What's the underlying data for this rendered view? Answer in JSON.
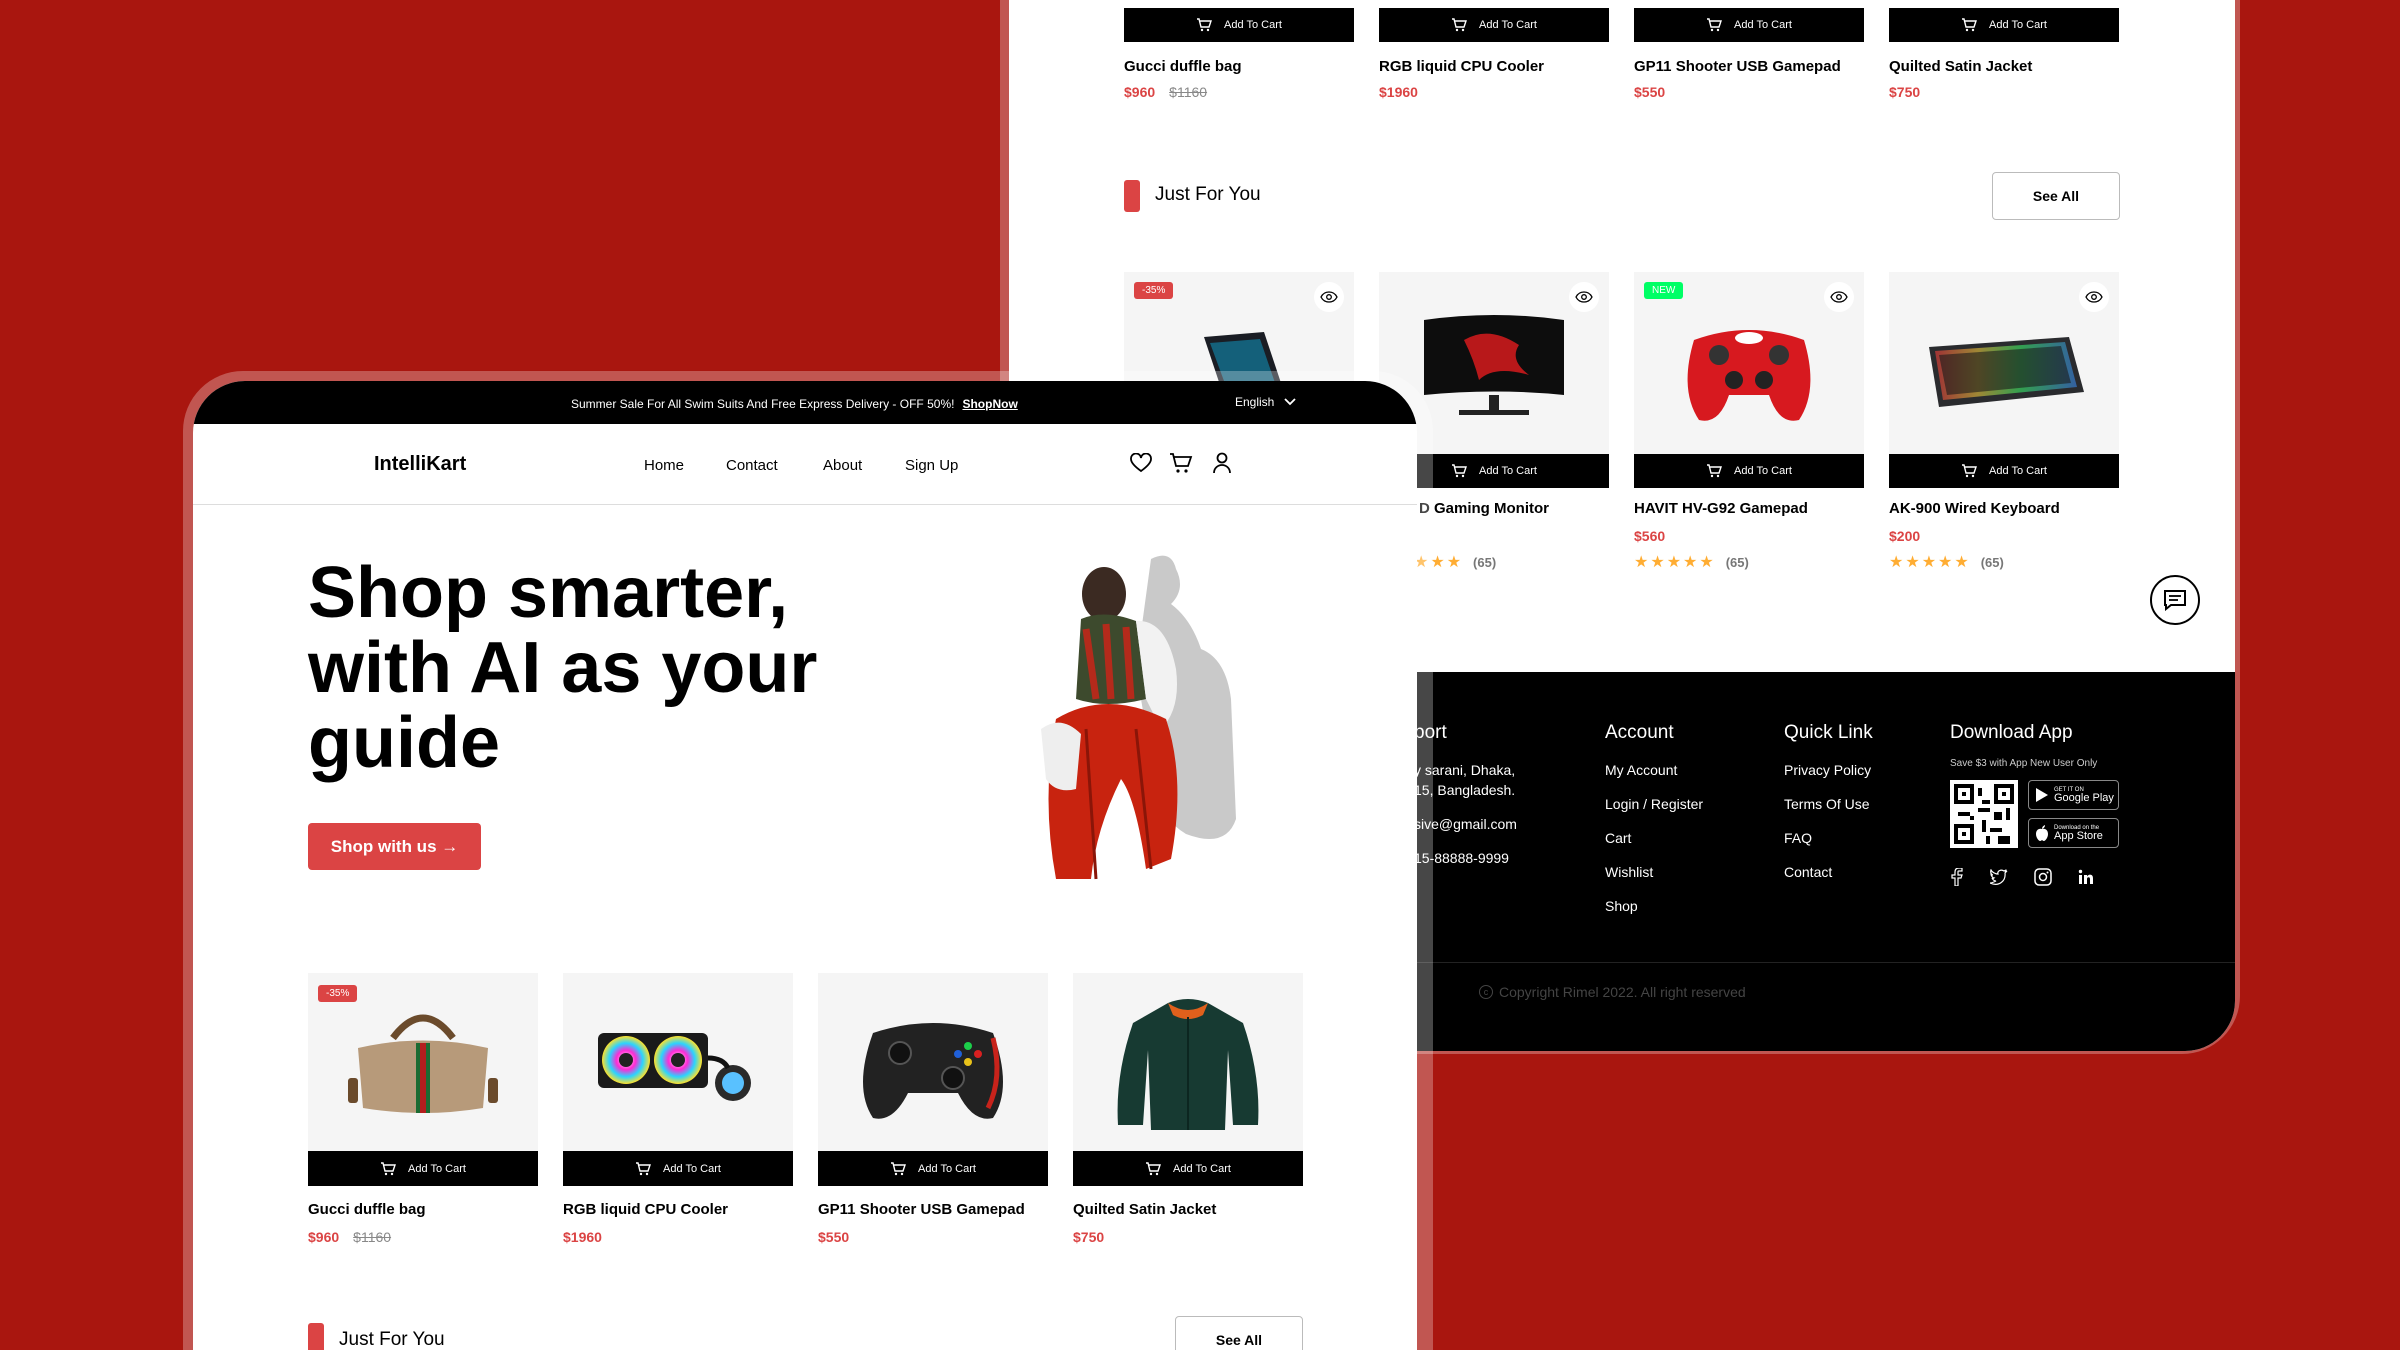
{
  "back": {
    "top_products": [
      {
        "name": "Gucci duffle bag",
        "price": "$960",
        "old_price": "$1160"
      },
      {
        "name": "RGB liquid CPU Cooler",
        "price": "$1960"
      },
      {
        "name": "GP11 Shooter USB Gamepad",
        "price": "$550"
      },
      {
        "name": "Quilted Satin Jacket",
        "price": "$750"
      }
    ],
    "add_to_cart": "Add To Cart",
    "section_title": "Just For You",
    "see_all": "See All",
    "jfy": [
      {
        "badge": "-35%",
        "badge_color": "#db4444"
      },
      {
        "name": "D Gaming Monitor",
        "rating_count": "(65)",
        "stars": "★★★"
      },
      {
        "badge": "NEW",
        "badge_color": "#00ff66",
        "name": "HAVIT HV-G92 Gamepad",
        "price": "$560",
        "rating_count": "(65)",
        "stars": "★★★★★"
      },
      {
        "name": "AK-900 Wired Keyboard",
        "price": "$200",
        "rating_count": "(65)",
        "stars": "★★★★★"
      }
    ],
    "footer": {
      "support_title": "port",
      "address_1": "y sarani, Dhaka,",
      "address_2": "15, Bangladesh.",
      "email": "sive@gmail.com",
      "phone": "15-88888-9999",
      "account_title": "Account",
      "account_items": [
        "My Account",
        "Login / Register",
        "Cart",
        "Wishlist",
        "Shop"
      ],
      "quick_title": "Quick Link",
      "quick_items": [
        "Privacy Policy",
        "Terms Of Use",
        "FAQ",
        "Contact"
      ],
      "app_title": "Download App",
      "app_sub": "Save $3 with App New User Only",
      "google_small": "GET IT ON",
      "google_big": "Google Play",
      "apple_small": "Download on the",
      "apple_big": "App Store",
      "copyright": "Copyright Rimel 2022. All right reserved"
    }
  },
  "front": {
    "topbar_text": "Summer Sale For All Swim Suits And Free Express Delivery - OFF 50%!",
    "topbar_link": "ShopNow",
    "language": "English",
    "logo": "IntelliKart",
    "nav": [
      "Home",
      "Contact",
      "About",
      "Sign Up"
    ],
    "hero_line1": "Shop smarter,",
    "hero_line2": "with AI as your",
    "hero_line3": "guide",
    "cta": "Shop with us →",
    "add_to_cart": "Add To Cart",
    "products": [
      {
        "name": "Gucci duffle bag",
        "price": "$960",
        "old_price": "$1160",
        "badge": "-35%"
      },
      {
        "name": "RGB liquid CPU Cooler",
        "price": "$1960"
      },
      {
        "name": "GP11 Shooter USB Gamepad",
        "price": "$550"
      },
      {
        "name": "Quilted Satin Jacket",
        "price": "$750"
      }
    ],
    "section_title": "Just For You",
    "see_all": "See All"
  },
  "colors": {
    "accent": "#db4444",
    "background": "#a9160f",
    "new_badge": "#00ff66",
    "star": "#ffad33"
  }
}
